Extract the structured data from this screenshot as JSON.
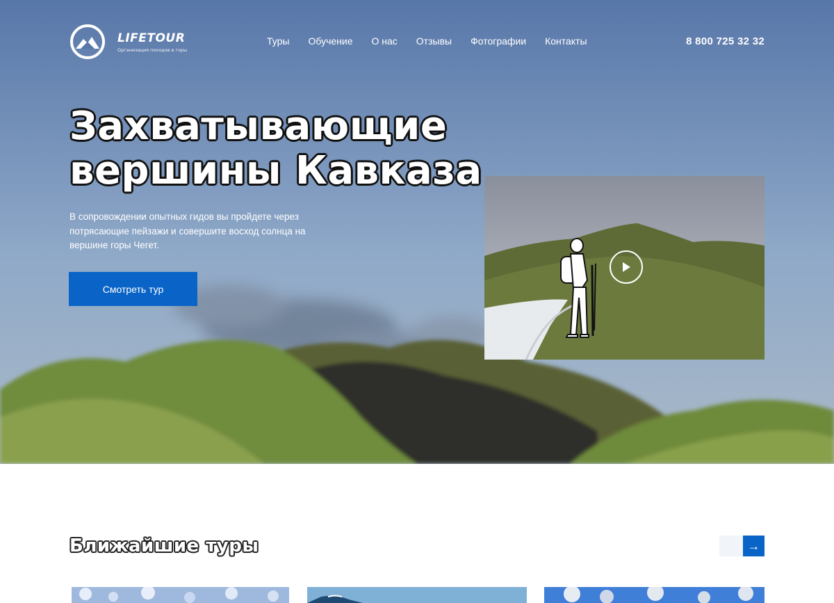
{
  "header": {
    "logo_name": "LIFETOUR",
    "logo_tagline": "Организация походов в горы",
    "nav": [
      "Туры",
      "Обучение",
      "О нас",
      "Отзывы",
      "Фотографии",
      "Контакты"
    ],
    "phone": "8 800 725 32 32"
  },
  "hero": {
    "title_line1": "Захватывающие",
    "title_line2": "вершины Кавказа",
    "description": "В сопровождении опытных гидов вы пройдете через потрясающие пейзажи и совершите восход солнца на вершине горы Чегет.",
    "button_label": "Смотреть тур",
    "video_play_icon": "play-icon"
  },
  "tours": {
    "title": "Ближайшие туры",
    "prev_icon": "arrow-left-icon",
    "next_icon": "arrow-right-icon",
    "next_glyph": "→"
  },
  "colors": {
    "accent": "#0a64c8",
    "sky_top": "#5b7fb0",
    "sky_bottom": "#aec3d8",
    "hill_green": "#6b8a3a"
  }
}
